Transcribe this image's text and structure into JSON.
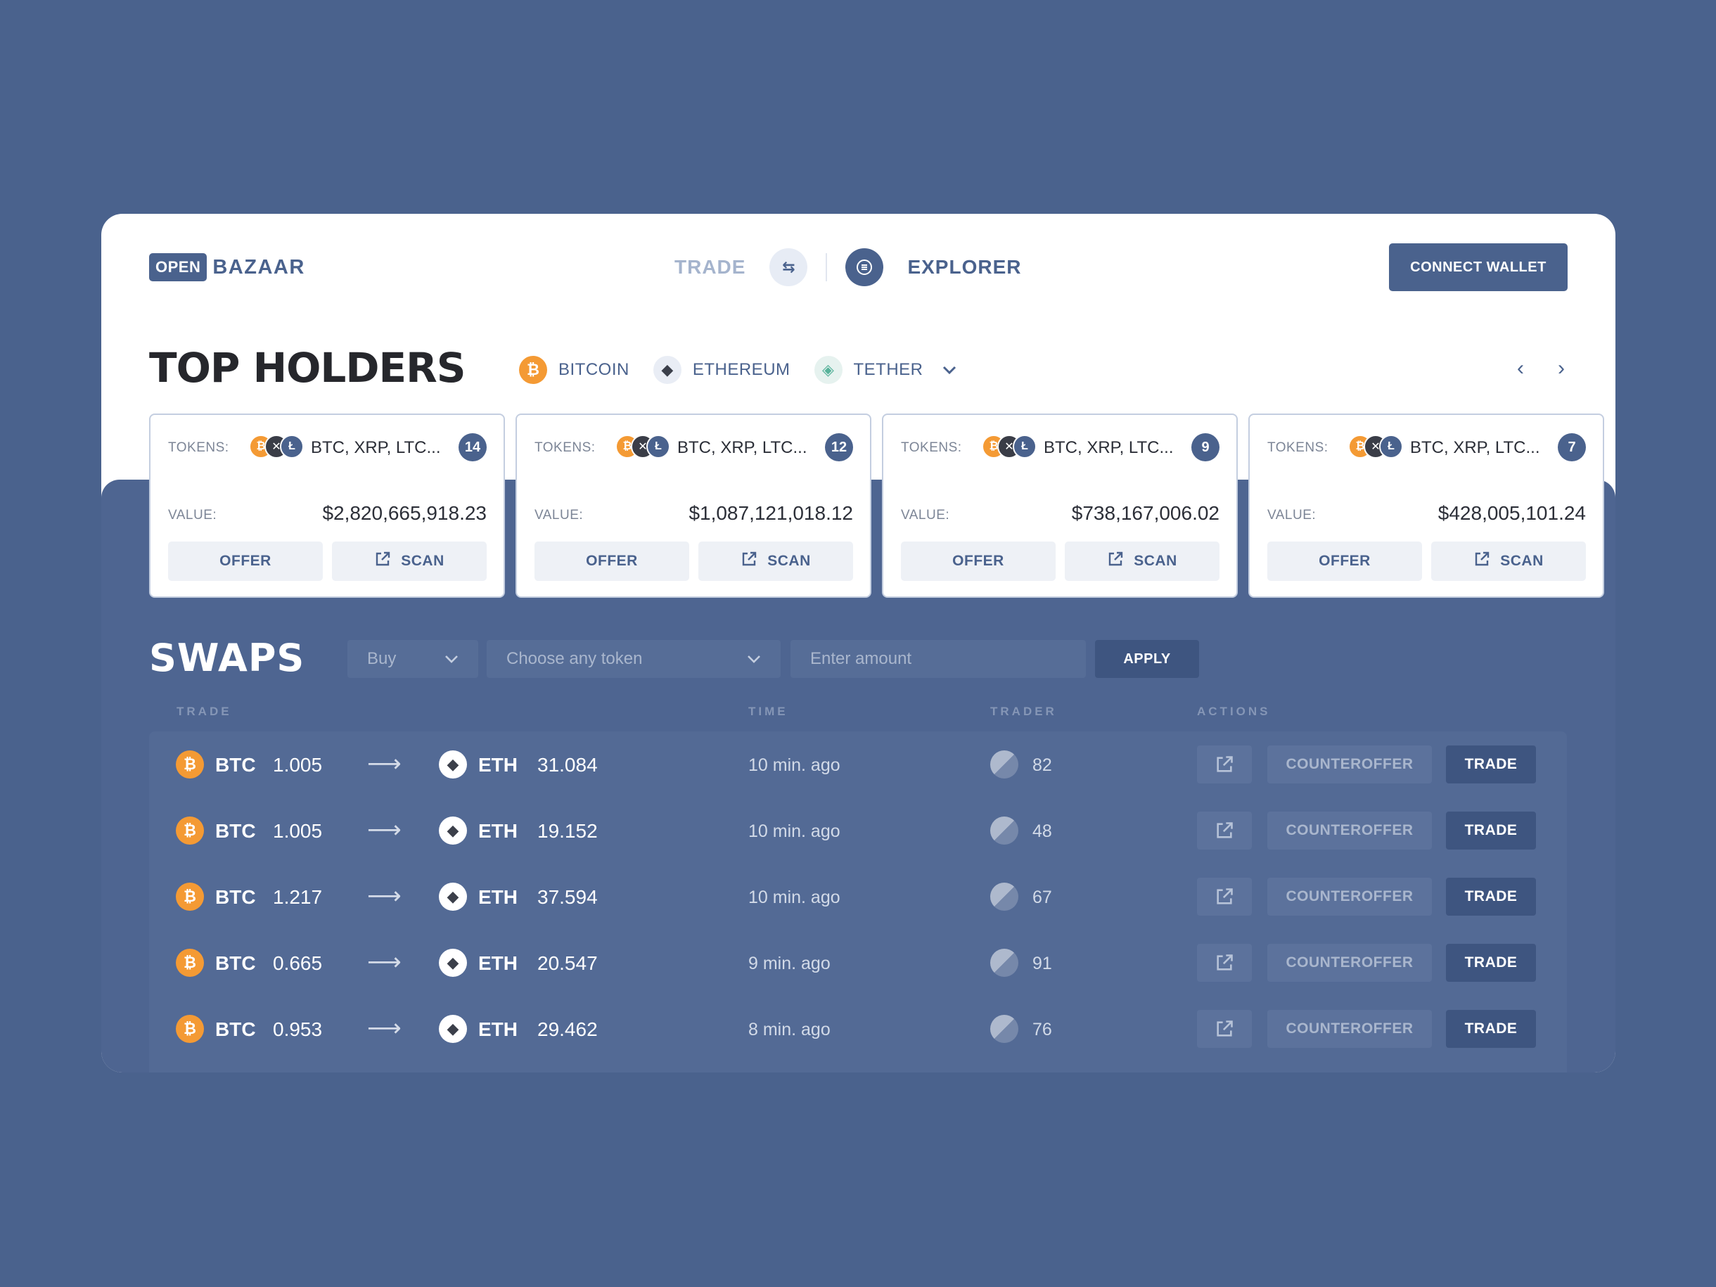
{
  "header": {
    "logo_box": "OPEN",
    "logo_text": "BAZAAR",
    "nav_trade": "TRADE",
    "nav_explorer": "EXPLORER",
    "connect_wallet": "CONNECT WALLET"
  },
  "top_holders": {
    "title": "TOP HOLDERS",
    "filters": [
      {
        "label": "BITCOIN",
        "icon": "bitcoin-icon"
      },
      {
        "label": "ETHEREUM",
        "icon": "ethereum-icon"
      },
      {
        "label": "TETHER",
        "icon": "tether-icon"
      }
    ],
    "tokens_label": "TOKENS:",
    "value_label": "VALUE:",
    "offer_label": "OFFER",
    "scan_label": "SCAN",
    "cards": [
      {
        "tokens": "BTC, XRP, LTC...",
        "count": "14",
        "value": "$2,820,665,918.23"
      },
      {
        "tokens": "BTC, XRP, LTC...",
        "count": "12",
        "value": "$1,087,121,018.12"
      },
      {
        "tokens": "BTC, XRP, LTC...",
        "count": "9",
        "value": "$738,167,006.02"
      },
      {
        "tokens": "BTC, XRP, LTC...",
        "count": "7",
        "value": "$428,005,101.24"
      }
    ]
  },
  "swaps": {
    "title": "SWAPS",
    "buy_select": "Buy",
    "token_select_placeholder": "Choose any token",
    "amount_placeholder": "Enter amount",
    "apply": "APPLY",
    "columns": {
      "trade": "TRADE",
      "time": "TIME",
      "trader": "TRADER",
      "actions": "ACTIONS"
    },
    "counteroffer_label": "COUNTEROFFER",
    "trade_label": "TRADE",
    "rows": [
      {
        "from_sym": "BTC",
        "from_amt": "1.005",
        "to_sym": "ETH",
        "to_amt": "31.084",
        "time": "10 min. ago",
        "trader": "82"
      },
      {
        "from_sym": "BTC",
        "from_amt": "1.005",
        "to_sym": "ETH",
        "to_amt": "19.152",
        "time": "10 min. ago",
        "trader": "48"
      },
      {
        "from_sym": "BTC",
        "from_amt": "1.217",
        "to_sym": "ETH",
        "to_amt": "37.594",
        "time": "10 min. ago",
        "trader": "67"
      },
      {
        "from_sym": "BTC",
        "from_amt": "0.665",
        "to_sym": "ETH",
        "to_amt": "20.547",
        "time": "9 min. ago",
        "trader": "91"
      },
      {
        "from_sym": "BTC",
        "from_amt": "0.953",
        "to_sym": "ETH",
        "to_amt": "29.462",
        "time": "8 min. ago",
        "trader": "76"
      }
    ]
  },
  "colors": {
    "page_bg": "#4a628d",
    "accent": "#4a628d",
    "bitcoin": "#f49a34",
    "tether": "#57b29a"
  }
}
